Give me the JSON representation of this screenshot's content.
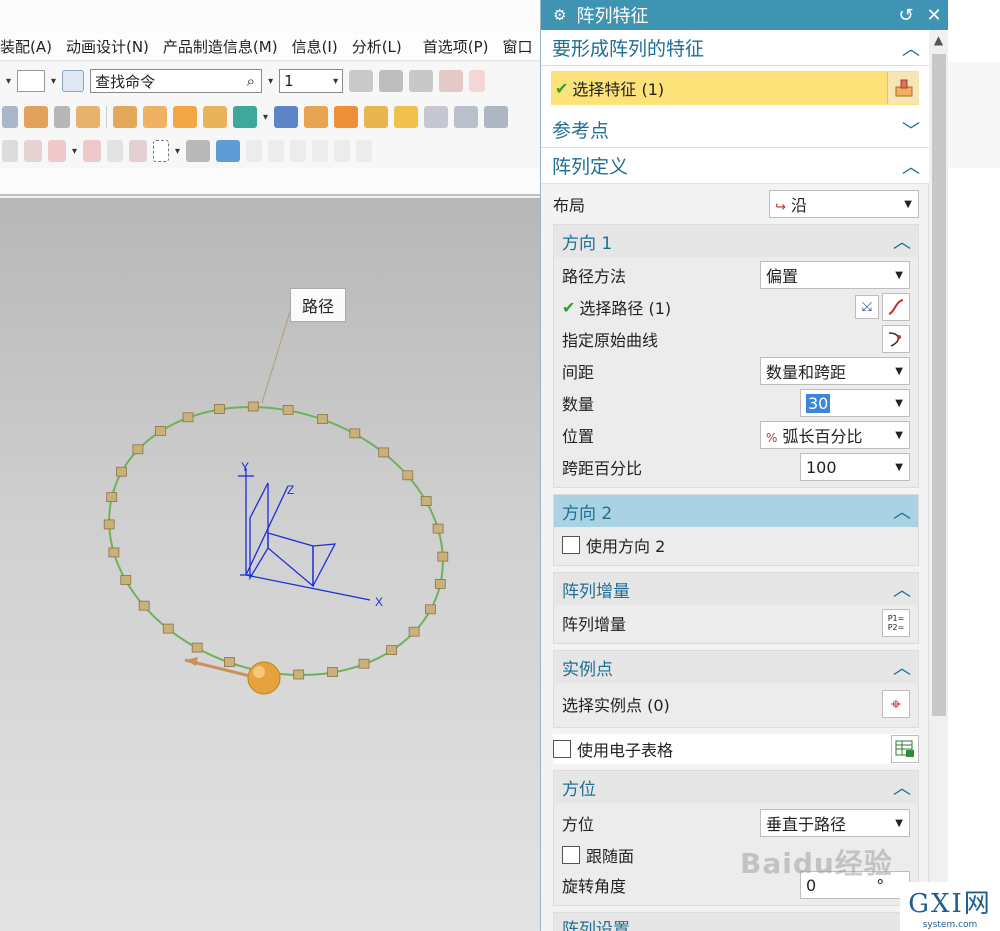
{
  "menubar": [
    "装配(A)",
    "动画设计(N)",
    "产品制造信息(M)",
    "信息(I)",
    "分析(L)",
    "首选项(P)",
    "窗口"
  ],
  "toolbar": {
    "find_command": "查找命令",
    "filter_value": "1"
  },
  "viewport": {
    "path_label": "路径",
    "axes": {
      "x": "X",
      "y": "Y",
      "z": "Z"
    },
    "instance_count": 30
  },
  "dialog": {
    "title": "阵列特征",
    "features_section": {
      "title": "要形成阵列的特征",
      "select_label": "选择特征 (1)"
    },
    "reference_section": {
      "title": "参考点"
    },
    "definition_section": {
      "title": "阵列定义",
      "layout_label": "布局",
      "layout_value": "沿",
      "direction1": {
        "title": "方向 1",
        "path_method_label": "路径方法",
        "path_method_value": "偏置",
        "select_path_label": "选择路径 (1)",
        "specify_curve_label": "指定原始曲线",
        "spacing_label": "间距",
        "spacing_value": "数量和跨距",
        "count_label": "数量",
        "count_value": "30",
        "position_label": "位置",
        "position_value": "弧长百分比",
        "span_label": "跨距百分比",
        "span_value": "100"
      },
      "direction2": {
        "title": "方向 2",
        "use_label": "使用方向 2"
      },
      "increment": {
        "title": "阵列增量",
        "label": "阵列增量"
      },
      "instance_points": {
        "title": "实例点",
        "label": "选择实例点 (0)"
      },
      "use_spreadsheet_label": "使用电子表格",
      "orientation": {
        "title": "方位",
        "label": "方位",
        "value": "垂直于路径",
        "follow_face_label": "跟随面",
        "rotation_label": "旋转角度",
        "rotation_value": "0",
        "rotation_unit": "°"
      },
      "array_settings_title": "阵列设置"
    }
  },
  "watermark": "Baidu经验",
  "corner_logo": {
    "big": "GXI网",
    "small": "system.com"
  },
  "colors": {
    "title_bar": "#3f93b3",
    "accent": "#1d6f95",
    "select_highlight": "#fde27a",
    "path_curve": "#6fb15a",
    "instance_block": "#c9b27a"
  }
}
